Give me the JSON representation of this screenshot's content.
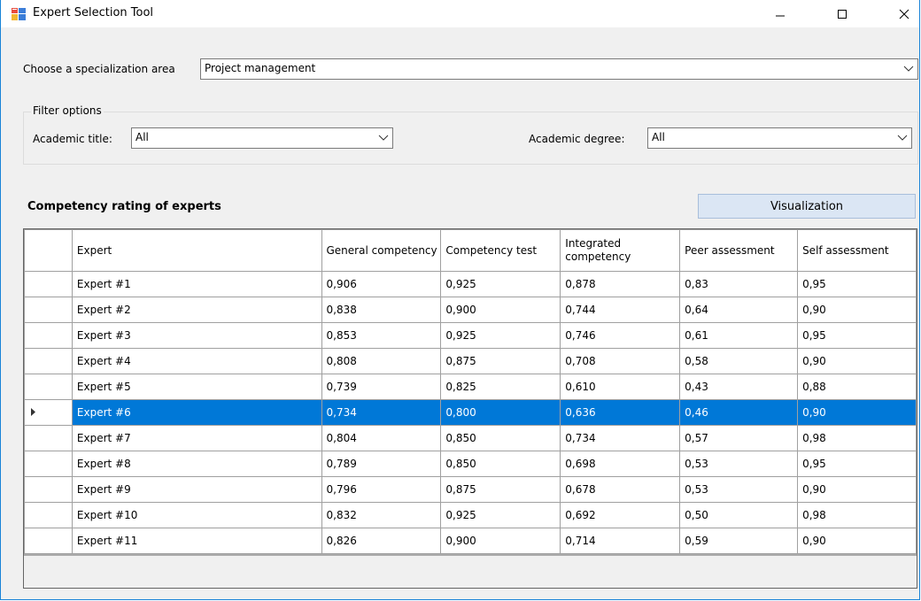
{
  "window": {
    "title": "Expert Selection Tool",
    "icon": "app-form-icon"
  },
  "specialization": {
    "label": "Choose a specialization area",
    "value": "Project management"
  },
  "filter": {
    "group_title": "Filter options",
    "academic_title_label": "Academic title:",
    "academic_title_value": "All",
    "academic_degree_label": "Academic degree:",
    "academic_degree_value": "All"
  },
  "section": {
    "title": "Competency rating of experts",
    "visualization_button": "Visualization"
  },
  "table": {
    "columns": [
      "Expert",
      "General competency",
      "Competency test",
      "Integrated competency",
      "Peer assessment",
      "Self assessment"
    ],
    "selected_row_index": 5,
    "rows": [
      [
        "Expert #1",
        "0,906",
        "0,925",
        "0,878",
        "0,83",
        "0,95"
      ],
      [
        "Expert #2",
        "0,838",
        "0,900",
        "0,744",
        "0,64",
        "0,90"
      ],
      [
        "Expert #3",
        "0,853",
        "0,925",
        "0,746",
        "0,61",
        "0,95"
      ],
      [
        "Expert #4",
        "0,808",
        "0,875",
        "0,708",
        "0,58",
        "0,90"
      ],
      [
        "Expert #5",
        "0,739",
        "0,825",
        "0,610",
        "0,43",
        "0,88"
      ],
      [
        "Expert #6",
        "0,734",
        "0,800",
        "0,636",
        "0,46",
        "0,90"
      ],
      [
        "Expert #7",
        "0,804",
        "0,850",
        "0,734",
        "0,57",
        "0,98"
      ],
      [
        "Expert #8",
        "0,789",
        "0,850",
        "0,698",
        "0,53",
        "0,95"
      ],
      [
        "Expert #9",
        "0,796",
        "0,875",
        "0,678",
        "0,53",
        "0,90"
      ],
      [
        "Expert #10",
        "0,832",
        "0,925",
        "0,692",
        "0,50",
        "0,98"
      ],
      [
        "Expert #11",
        "0,826",
        "0,900",
        "0,714",
        "0,59",
        "0,90"
      ]
    ]
  },
  "colors": {
    "selection": "#0078d7",
    "window_border": "#1883d7",
    "button_face": "#dbe6f4",
    "form_background": "#f0f0f0"
  }
}
